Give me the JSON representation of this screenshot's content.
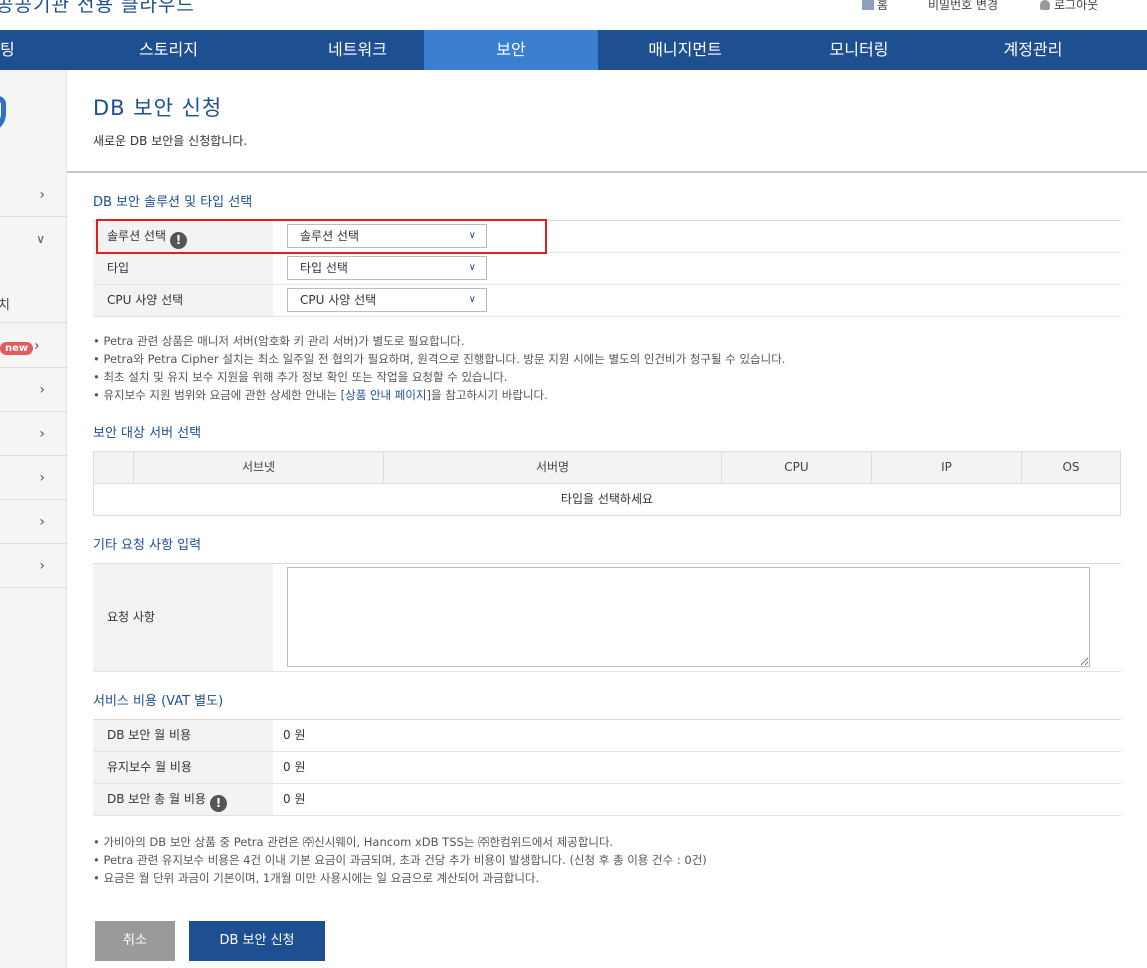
{
  "header": {
    "brand": "공공기관 전용 클라우드",
    "util_links": [
      "홈",
      "비밀번호 변경",
      "로그아웃"
    ]
  },
  "nav": {
    "items": [
      "팅",
      "스토리지",
      "네트워크",
      "보안",
      "매니지먼트",
      "모니터링",
      "계정관리"
    ],
    "active": "보안"
  },
  "sidebar": {
    "new_badge": "new",
    "sub_item": "치"
  },
  "page": {
    "title": "DB 보안 신청",
    "description": "새로운 DB 보안을 신청합니다."
  },
  "solution_section": {
    "title": "DB 보안 솔루션 및 타입 선택",
    "rows": [
      {
        "label": "솔루션 선택",
        "value": "솔루션 선택"
      },
      {
        "label": "타입",
        "value": "타입 선택"
      },
      {
        "label": "CPU 사양 선택",
        "value": "CPU 사양 선택"
      }
    ],
    "notes": [
      "Petra 관련 상품은 매니저 서버(암호화 키 관리 서버)가 별도로 필요합니다.",
      "Petra와 Petra Cipher 설치는 최소 일주일 전 협의가 필요하며, 원격으로 진행합니다. 방문 지원 시에는 별도의 인건비가 청구될 수 있습니다.",
      "최초 설치 및 유지 보수 지원을 위해 추가 정보 확인 또는 작업을 요청할 수 있습니다."
    ],
    "note_last_prefix": "유지보수 지원 범위와 요금에 관한 상세한 안내는 [",
    "note_last_link": "상품 안내 페이지",
    "note_last_suffix": "]을 참고하시기 바랍니다."
  },
  "server_section": {
    "title": "보안 대상 서버 선택",
    "columns": [
      "",
      "서브넷",
      "서버명",
      "CPU",
      "IP",
      "OS"
    ],
    "empty_message": "타입을 선택하세요"
  },
  "request_section": {
    "title": "기타 요청 사항 입력",
    "label": "요청 사항",
    "value": ""
  },
  "cost_section": {
    "title": "서비스 비용 (VAT 별도)",
    "rows": [
      {
        "label": "DB 보안 월 비용",
        "value": "0 원"
      },
      {
        "label": "유지보수 월 비용",
        "value": "0 원"
      },
      {
        "label": "DB 보안 총 월 비용",
        "value": "0 원"
      }
    ],
    "notes": [
      "가비아의 DB 보안 상품 중 Petra 관련은 ㈜신시웨이, Hancom xDB TSS는 ㈜한컴위드에서 제공합니다.",
      "Petra 관련 유지보수 비용은 4건 이내 기본 요금이 과금되며, 초과 건당 추가 비용이 발생합니다. (신청 후 총 이용 건수 : 0건)",
      "요금은 월 단위 과금이 기본이며, 1개월 미만 사용시에는 일 요금으로 계산되어 과금합니다."
    ]
  },
  "buttons": {
    "cancel": "취소",
    "apply": "DB 보안 신청"
  }
}
